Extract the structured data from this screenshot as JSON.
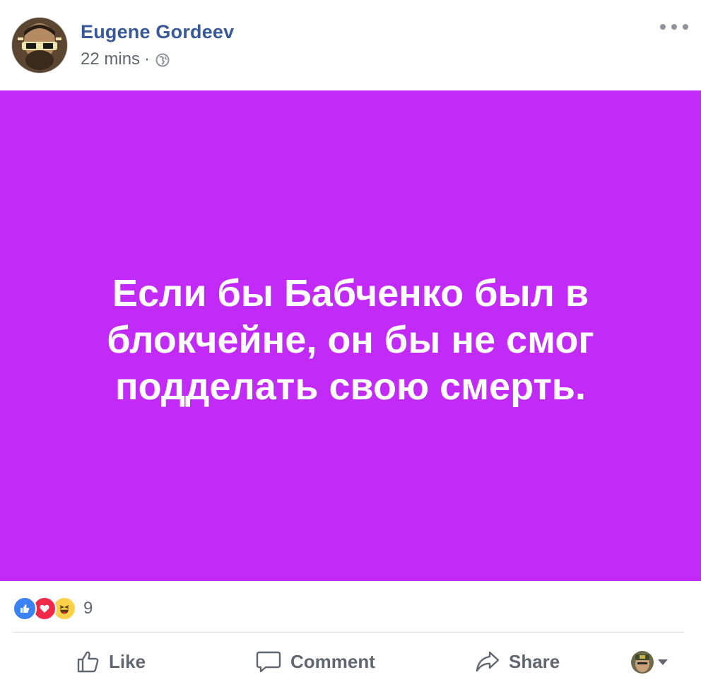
{
  "post": {
    "author": "Eugene Gordeev",
    "time": "22 mins",
    "separator": "·",
    "audience_icon": "globe-icon",
    "status_text": "Если бы Бабченко был в блокчейне, он бы не смог подделать свою смерть.",
    "card_color": "#c22af8"
  },
  "reactions": {
    "icons": [
      "like-icon",
      "love-icon",
      "haha-icon"
    ],
    "count": "9"
  },
  "actions": {
    "like": "Like",
    "comment": "Comment",
    "share": "Share"
  },
  "colors": {
    "name": "#385898",
    "meta": "#616770",
    "action_text": "#606770",
    "like_blue": "#3b82f6",
    "love_red": "#f0284a",
    "haha_yellow": "#fbd14b"
  }
}
